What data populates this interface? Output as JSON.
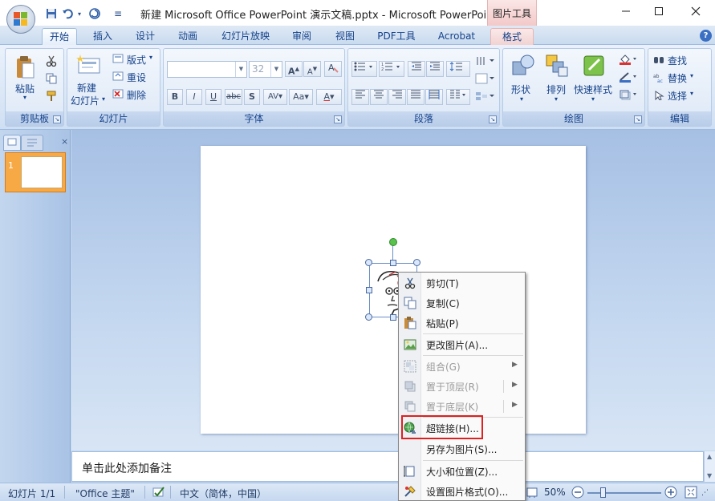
{
  "titlebar": {
    "title": "新建 Microsoft Office PowerPoint 演示文稿.pptx - Microsoft PowerPoint",
    "context_tool": "图片工具",
    "qat_customize": "≡"
  },
  "tabs": [
    "开始",
    "插入",
    "设计",
    "动画",
    "幻灯片放映",
    "审阅",
    "视图",
    "PDF工具",
    "Acrobat",
    "格式"
  ],
  "help_label": "?",
  "ribbon": {
    "clipboard": {
      "paste": "粘贴",
      "label": "剪贴板"
    },
    "slides": {
      "new_slide_line1": "新建",
      "new_slide_line2": "幻灯片",
      "layout": "版式",
      "reset": "重设",
      "delete": "删除",
      "label": "幻灯片"
    },
    "font": {
      "font_size": "32",
      "grow": "A",
      "shrink": "A",
      "bold": "B",
      "italic": "I",
      "underline": "U",
      "strike": "abc",
      "shadow": "S",
      "spacing": "AV",
      "case": "Aa",
      "color": "A",
      "label": "字体"
    },
    "paragraph": {
      "label": "段落"
    },
    "drawing": {
      "shapes": "形状",
      "arrange": "排列",
      "quick_styles": "快速样式",
      "label": "绘图"
    },
    "editing": {
      "find": "查找",
      "replace": "替换",
      "select": "选择",
      "label": "编辑"
    }
  },
  "slide_panel": {
    "number": "1",
    "close": "×"
  },
  "notes_placeholder": "单击此处添加备注",
  "statusbar": {
    "slide_count": "幻灯片 1/1",
    "theme": "\"Office 主题\"",
    "language": "中文（简体，中国）",
    "zoom": "50%"
  },
  "context_menu": [
    {
      "label": "剪切(T)",
      "icon": "scissors-icon",
      "disabled": false
    },
    {
      "label": "复制(C)",
      "icon": "copy-icon",
      "disabled": false
    },
    {
      "label": "粘贴(P)",
      "icon": "paste-icon",
      "disabled": false
    },
    {
      "label": "更改图片(A)...",
      "icon": "change-picture-icon",
      "disabled": false
    },
    {
      "label": "组合(G)",
      "icon": "group-icon",
      "disabled": true,
      "submenu": true
    },
    {
      "label": "置于顶层(R)",
      "icon": "bring-front-icon",
      "disabled": true,
      "submenu": true
    },
    {
      "label": "置于底层(K)",
      "icon": "send-back-icon",
      "disabled": true,
      "submenu": true
    },
    {
      "label": "超链接(H)...",
      "icon": "hyperlink-icon",
      "disabled": false
    },
    {
      "label": "另存为图片(S)...",
      "icon": "",
      "disabled": false
    },
    {
      "label": "大小和位置(Z)...",
      "icon": "size-position-icon",
      "disabled": false
    },
    {
      "label": "设置图片格式(O)...",
      "icon": "format-picture-icon",
      "disabled": false
    }
  ],
  "colors": {
    "highlight": "#e02020",
    "ribbon_text": "#15428b",
    "thumb_selected": "#f6a945"
  }
}
